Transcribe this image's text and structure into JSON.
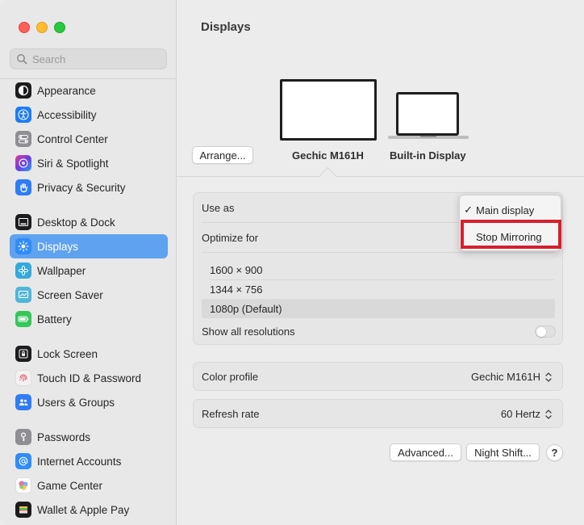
{
  "sidebar": {
    "search": {
      "placeholder": "Search",
      "value": ""
    },
    "items": [
      {
        "label": "Appearance",
        "icon": "appearance-icon",
        "color": "#1c1c1e"
      },
      {
        "label": "Accessibility",
        "icon": "accessibility-icon",
        "color": "#1e7cf2"
      },
      {
        "label": "Control Center",
        "icon": "control-center-icon",
        "color": "#8e8e93"
      },
      {
        "label": "Siri & Spotlight",
        "icon": "siri-icon",
        "color": "#6a3be0"
      },
      {
        "label": "Privacy & Security",
        "icon": "privacy-hand-icon",
        "color": "#2e7cf6"
      },
      {
        "label": "Desktop & Dock",
        "icon": "desktop-dock-icon",
        "color": "#1c1c1e"
      },
      {
        "label": "Displays",
        "icon": "displays-sun-icon",
        "color": "#2f8cf8",
        "active": true
      },
      {
        "label": "Wallpaper",
        "icon": "wallpaper-flower-icon",
        "color": "#34aadc"
      },
      {
        "label": "Screen Saver",
        "icon": "screen-saver-icon",
        "color": "#4fb6d9"
      },
      {
        "label": "Battery",
        "icon": "battery-icon",
        "color": "#34c759"
      },
      {
        "label": "Lock Screen",
        "icon": "lock-screen-icon",
        "color": "#1c1c1e"
      },
      {
        "label": "Touch ID & Password",
        "icon": "fingerprint-icon",
        "color": "#f2f2f2"
      },
      {
        "label": "Users & Groups",
        "icon": "users-icon",
        "color": "#2f7cf6"
      },
      {
        "label": "Passwords",
        "icon": "key-icon",
        "color": "#8e8e93"
      },
      {
        "label": "Internet Accounts",
        "icon": "at-icon",
        "color": "#2f8cf8"
      },
      {
        "label": "Game Center",
        "icon": "game-center-icon",
        "color": "#ffffff"
      },
      {
        "label": "Wallet & Apple Pay",
        "icon": "wallet-icon",
        "color": "#1c1c1e"
      }
    ]
  },
  "main": {
    "title": "Displays",
    "arrange_button": "Arrange...",
    "displays": [
      {
        "label": "Gechic M161H",
        "selected": true
      },
      {
        "label": "Built-in Display",
        "selected": false
      }
    ],
    "use_as": {
      "label": "Use as",
      "menu": [
        {
          "label": "Main display",
          "checked": true
        },
        {
          "label": "Stop Mirroring",
          "checked": false,
          "highlighted": true
        }
      ],
      "check_glyph": "✓"
    },
    "optimize_for": {
      "label": "Optimize for"
    },
    "resolutions": [
      {
        "label": "1600 × 900",
        "selected": false
      },
      {
        "label": "1344 × 756",
        "selected": false
      },
      {
        "label": "1080p (Default)",
        "selected": true
      }
    ],
    "show_all_resolutions": {
      "label": "Show all resolutions",
      "on": false
    },
    "color_profile": {
      "label": "Color profile",
      "value": "Gechic M161H"
    },
    "refresh_rate": {
      "label": "Refresh rate",
      "value": "60 Hertz"
    },
    "buttons": {
      "advanced": "Advanced...",
      "night_shift": "Night Shift...",
      "help": "?"
    }
  },
  "colors": {
    "accent": "#5ea2f0",
    "highlight_border": "#d6202e"
  }
}
